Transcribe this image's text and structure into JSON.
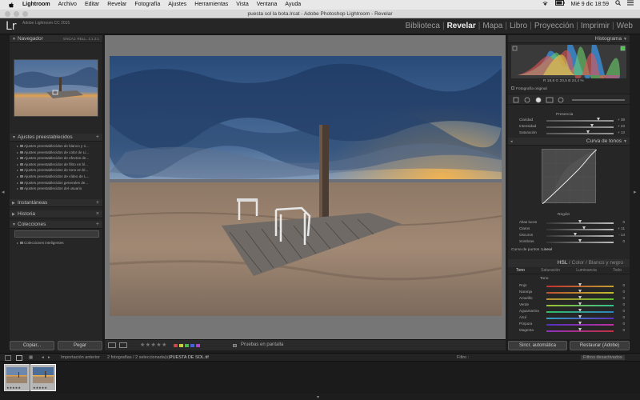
{
  "menubar": {
    "app": "Lightroom",
    "items": [
      "Archivo",
      "Editar",
      "Revelar",
      "Fotografía",
      "Ajustes",
      "Herramientas",
      "Vista",
      "Ventana",
      "Ayuda"
    ],
    "clock": "Mié 9 dic  18:59"
  },
  "window": {
    "title": "puesta sol la bota.lrcat - Adobe Photoshop Lightroom - Revelar"
  },
  "identity": {
    "logo": "Lr",
    "version": "Adobe Lightroom CC 2015"
  },
  "modules": [
    {
      "label": "Biblioteca"
    },
    {
      "label": "Revelar",
      "active": true
    },
    {
      "label": "Mapa"
    },
    {
      "label": "Libro"
    },
    {
      "label": "Proyección"
    },
    {
      "label": "Imprimir"
    },
    {
      "label": "Web"
    }
  ],
  "left_panel": {
    "navigator": {
      "title": "Navegador",
      "zoom": "ENCAJ.  RELL.  1:1  2:1"
    },
    "presets": {
      "title": "Ajustes preestablecidos",
      "items": [
        "Ajustes preestablecidos de blanco y n...",
        "Ajustes preestablecidos de color de Li...",
        "Ajustes preestablecidos de efectos de...",
        "Ajustes preestablecidos de filtro en bl...",
        "Ajustes preestablecidos de tono en bl...",
        "Ajustes preestablecidos de vídeo de L...",
        "Ajustes preestablecidos generales de...",
        "Ajustes preestablecidos del usuario"
      ]
    },
    "snapshots": {
      "title": "Instantáneas"
    },
    "history": {
      "title": "Historia"
    },
    "collections": {
      "title": "Colecciones",
      "items": [
        "Colecciones inteligentes"
      ]
    },
    "buttons": {
      "copy": "Copiar...",
      "paste": "Pegar"
    }
  },
  "toolbar": {
    "rating": "★★★★★",
    "proof_label": "Pruebas en pantalla"
  },
  "right_panel": {
    "histogram": {
      "title": "Histograma",
      "readout": "R  19,8   G  20,5   B  24,4 %",
      "original_photo": "Fotografía original"
    },
    "presence": {
      "title": "Presencia",
      "rows": [
        {
          "label": "Claridad",
          "value": "+ 39",
          "pos": 0.78
        },
        {
          "label": "Intensidad",
          "value": "+ 23",
          "pos": 0.68
        },
        {
          "label": "Saturación",
          "value": "+ 13",
          "pos": 0.62
        }
      ]
    },
    "tone_curve": {
      "title": "Curva de tonos",
      "region_title": "Región",
      "rows": [
        {
          "label": "Altas luces",
          "value": "0",
          "pos": 0.5
        },
        {
          "label": "Claros",
          "value": "+ 11",
          "pos": 0.56
        },
        {
          "label": "Oscuros",
          "value": "- 14",
          "pos": 0.43
        },
        {
          "label": "Sombras",
          "value": "0",
          "pos": 0.5
        }
      ],
      "point_curve_label": "Curva de puntos :",
      "point_curve_value": "Lineal"
    },
    "hsl": {
      "tabs": [
        "HSL",
        "Color",
        "Blanco y negro"
      ],
      "subtabs": [
        "Tono",
        "Saturación",
        "Luminancia",
        "Todo"
      ],
      "section_title": "Tono",
      "rows": [
        {
          "label": "Rojo",
          "value": "0",
          "c1": "#c03030",
          "c2": "#c0a030"
        },
        {
          "label": "Naranja",
          "value": "0",
          "c1": "#c05030",
          "c2": "#c0c030"
        },
        {
          "label": "Amarillo",
          "value": "0",
          "c1": "#c09030",
          "c2": "#60c030"
        },
        {
          "label": "Verde",
          "value": "0",
          "c1": "#a0c030",
          "c2": "#30c090"
        },
        {
          "label": "Aguamarina",
          "value": "0",
          "c1": "#30c060",
          "c2": "#3080c0"
        },
        {
          "label": "Azul",
          "value": "0",
          "c1": "#30a0c0",
          "c2": "#6030c0"
        },
        {
          "label": "Púrpura",
          "value": "0",
          "c1": "#5030c0",
          "c2": "#c030a0"
        },
        {
          "label": "Magenta",
          "value": "0",
          "c1": "#9030c0",
          "c2": "#c03040"
        }
      ]
    },
    "buttons": {
      "sync": "Sincr. automática",
      "reset": "Restaurar (Adobe)"
    }
  },
  "filmstrip": {
    "prev_import": "Importación anterior",
    "count": "2 fotografías / 2 seleccionada(s) /",
    "filename": "PUESTA DE SOL.tif",
    "filter_label": "Filtro :",
    "filter_value": "Filtros desactivados",
    "thumb_rating": "★★★★★"
  },
  "colors": {
    "accent": "#e8e8e8",
    "panel": "#262626",
    "background": "#1d1d1d",
    "canvas": "#767676"
  }
}
